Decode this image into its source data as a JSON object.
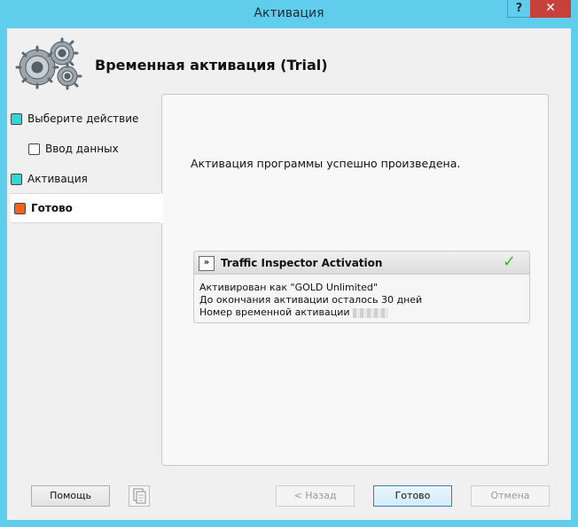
{
  "window": {
    "title": "Активация",
    "help_label": "?",
    "close_label": "✕"
  },
  "header": {
    "title": "Временная активация (Trial)",
    "icon": "gears-icon"
  },
  "steps": [
    {
      "label": "Выберите действие",
      "color": "#2fd7d7",
      "active": false
    },
    {
      "label": "Ввод данных",
      "color": "#ffffff",
      "active": false
    },
    {
      "label": "Активация",
      "color": "#2fd7d7",
      "active": false
    },
    {
      "label": "Готово",
      "color": "#f2641c",
      "active": true
    }
  ],
  "main": {
    "message": "Активация программы успешно произведена.",
    "info": {
      "expand_label": "»",
      "title": "Traffic Inspector Activation",
      "status_icon": "checkmark-icon",
      "lines": [
        "Активирован как \"GOLD Unlimited\"",
        "До окончания активации осталось 30 дней",
        "Номер временной активации"
      ]
    }
  },
  "footer": {
    "help_label": "Помощь",
    "copy_icon": "copy-icon",
    "back_label": "< Назад",
    "done_label": "Готово",
    "cancel_label": "Отмена"
  }
}
